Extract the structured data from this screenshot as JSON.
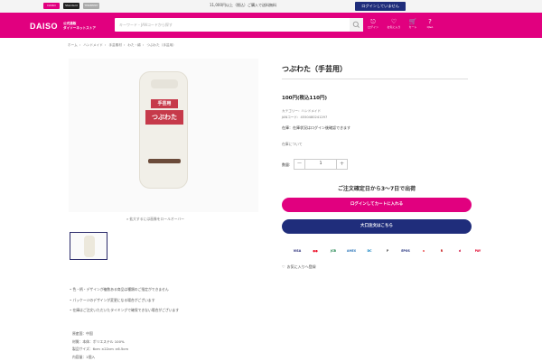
{
  "topbar": {
    "brands": [
      {
        "label": "DAISO",
        "color": "#e1007f"
      },
      {
        "label": "Standard",
        "color": "#222222"
      },
      {
        "label": "THREEPPY",
        "color": "#aaaaaa"
      }
    ],
    "notice": "11,000円以上（税込）ご購入で送料無料",
    "login_status": "ログインしていません"
  },
  "header": {
    "logo": "DAISO",
    "logo_sub_1": "公式通販",
    "logo_sub_2": "ダイソーネットストア",
    "search_placeholder": "キーワード・JANコードから探す",
    "icons": [
      {
        "glyph": "⎋",
        "label": "ログイン"
      },
      {
        "glyph": "♡",
        "label": "お気に入り"
      },
      {
        "glyph": "🛒",
        "label": "カート"
      },
      {
        "glyph": "?",
        "label": "Q&A"
      }
    ]
  },
  "breadcrumb": [
    "ホーム",
    "ハンドメイド",
    "手芸素材",
    "わた・綿",
    "つぶわた（手芸用）"
  ],
  "product": {
    "title": "つぶわた（手芸用）",
    "price": "100円(税込110円)",
    "category": "カテゴリー：ハンドメイド",
    "jan": "JANコード：4550480241297",
    "stock": "在庫：在庫状況はログイン後確認できます",
    "stock_link": "在庫について",
    "qty_label": "数量:",
    "qty_value": "1",
    "qty_minus": "－",
    "qty_plus": "+",
    "shipping": "ご注文確定日から3〜7日で出荷",
    "cart_button": "ログインしてカートに入れる",
    "store_button": "大口注文はこちら",
    "favorite": "お気に入りへ登録",
    "zoom_hint": "拡大するには画像をロールオーバー",
    "package_label_small": "手芸用",
    "package_label_big": "つぶわた"
  },
  "payments": [
    {
      "label": "VISA",
      "color": "#1a1f71"
    },
    {
      "label": "●●",
      "color": "#eb001b"
    },
    {
      "label": "JCB",
      "color": "#0b7a3e"
    },
    {
      "label": "AMEX",
      "color": "#2e77bb"
    },
    {
      "label": "DC",
      "color": "#0079be"
    },
    {
      "label": "P",
      "color": "#444444"
    },
    {
      "label": "EPOS",
      "color": "#1f2d7b"
    },
    {
      "label": "a",
      "color": "#e52e2e"
    },
    {
      "label": "R",
      "color": "#bf0000"
    },
    {
      "label": "d",
      "color": "#cc0033"
    },
    {
      "label": "PAY",
      "color": "#e0002a"
    }
  ],
  "notes": [
    "色・柄・デザインが複数ある商品は種類のご指定ができません",
    "パッケージのデザインが変更になる場合がございます",
    "在庫はご注文いただいたタイミングで確保できない場合がございます"
  ],
  "specs": [
    "原産国：中国",
    "材質：本体：ポリエステル 100%",
    "製品サイズ：6cm ×22cm ×6.5cm",
    "内容量：1個入"
  ]
}
